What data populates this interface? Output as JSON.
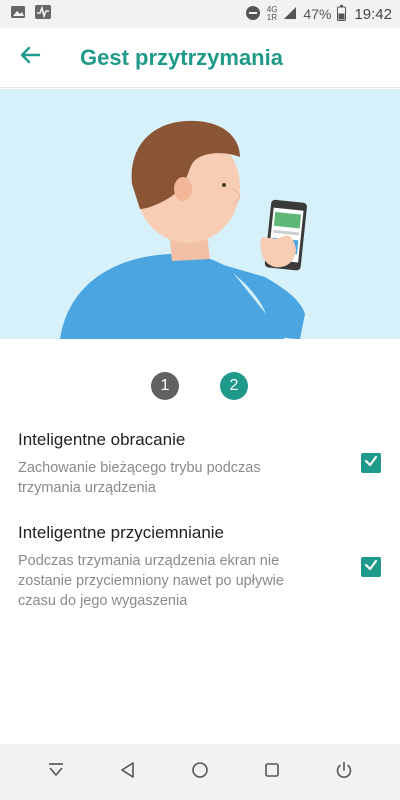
{
  "status_bar": {
    "left_icons": [
      "image-icon",
      "activity-icon"
    ],
    "network_top": "4G",
    "network_bottom": "1R",
    "battery_percent": "47%",
    "time": "19:42"
  },
  "app_bar": {
    "back_icon": "arrow-back-icon",
    "title": "Gest przytrzymania"
  },
  "pager": {
    "steps": [
      "1",
      "2"
    ],
    "active_step": 2
  },
  "settings": [
    {
      "title": "Inteligentne obracanie",
      "description": "Zachowanie bieżącego trybu podczas trzymania urządzenia",
      "checked": true
    },
    {
      "title": "Inteligentne przyciemnianie",
      "description": "Podczas trzymania urządzenia ekran nie zostanie przyciemniony nawet po upływie czasu do jego wygaszenia",
      "checked": true
    }
  ],
  "nav_bar": {
    "buttons": [
      "hide-nav-icon",
      "back-icon",
      "home-icon",
      "recents-icon",
      "power-icon"
    ]
  },
  "colors": {
    "accent": "#1f9a8a",
    "hero_bg": "#d7f1fa",
    "inactive_step": "#616161"
  }
}
